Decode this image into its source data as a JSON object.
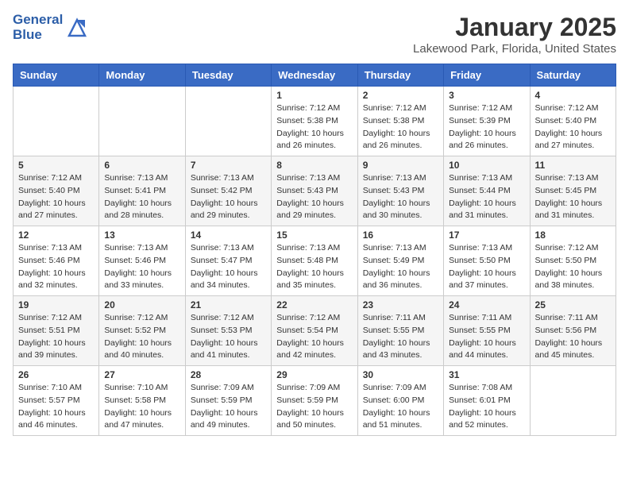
{
  "header": {
    "logo_general": "General",
    "logo_blue": "Blue",
    "title": "January 2025",
    "subtitle": "Lakewood Park, Florida, United States"
  },
  "weekdays": [
    "Sunday",
    "Monday",
    "Tuesday",
    "Wednesday",
    "Thursday",
    "Friday",
    "Saturday"
  ],
  "weeks": [
    [
      {
        "day": "",
        "info": ""
      },
      {
        "day": "",
        "info": ""
      },
      {
        "day": "",
        "info": ""
      },
      {
        "day": "1",
        "info": "Sunrise: 7:12 AM\nSunset: 5:38 PM\nDaylight: 10 hours\nand 26 minutes."
      },
      {
        "day": "2",
        "info": "Sunrise: 7:12 AM\nSunset: 5:38 PM\nDaylight: 10 hours\nand 26 minutes."
      },
      {
        "day": "3",
        "info": "Sunrise: 7:12 AM\nSunset: 5:39 PM\nDaylight: 10 hours\nand 26 minutes."
      },
      {
        "day": "4",
        "info": "Sunrise: 7:12 AM\nSunset: 5:40 PM\nDaylight: 10 hours\nand 27 minutes."
      }
    ],
    [
      {
        "day": "5",
        "info": "Sunrise: 7:12 AM\nSunset: 5:40 PM\nDaylight: 10 hours\nand 27 minutes."
      },
      {
        "day": "6",
        "info": "Sunrise: 7:13 AM\nSunset: 5:41 PM\nDaylight: 10 hours\nand 28 minutes."
      },
      {
        "day": "7",
        "info": "Sunrise: 7:13 AM\nSunset: 5:42 PM\nDaylight: 10 hours\nand 29 minutes."
      },
      {
        "day": "8",
        "info": "Sunrise: 7:13 AM\nSunset: 5:43 PM\nDaylight: 10 hours\nand 29 minutes."
      },
      {
        "day": "9",
        "info": "Sunrise: 7:13 AM\nSunset: 5:43 PM\nDaylight: 10 hours\nand 30 minutes."
      },
      {
        "day": "10",
        "info": "Sunrise: 7:13 AM\nSunset: 5:44 PM\nDaylight: 10 hours\nand 31 minutes."
      },
      {
        "day": "11",
        "info": "Sunrise: 7:13 AM\nSunset: 5:45 PM\nDaylight: 10 hours\nand 31 minutes."
      }
    ],
    [
      {
        "day": "12",
        "info": "Sunrise: 7:13 AM\nSunset: 5:46 PM\nDaylight: 10 hours\nand 32 minutes."
      },
      {
        "day": "13",
        "info": "Sunrise: 7:13 AM\nSunset: 5:46 PM\nDaylight: 10 hours\nand 33 minutes."
      },
      {
        "day": "14",
        "info": "Sunrise: 7:13 AM\nSunset: 5:47 PM\nDaylight: 10 hours\nand 34 minutes."
      },
      {
        "day": "15",
        "info": "Sunrise: 7:13 AM\nSunset: 5:48 PM\nDaylight: 10 hours\nand 35 minutes."
      },
      {
        "day": "16",
        "info": "Sunrise: 7:13 AM\nSunset: 5:49 PM\nDaylight: 10 hours\nand 36 minutes."
      },
      {
        "day": "17",
        "info": "Sunrise: 7:13 AM\nSunset: 5:50 PM\nDaylight: 10 hours\nand 37 minutes."
      },
      {
        "day": "18",
        "info": "Sunrise: 7:12 AM\nSunset: 5:50 PM\nDaylight: 10 hours\nand 38 minutes."
      }
    ],
    [
      {
        "day": "19",
        "info": "Sunrise: 7:12 AM\nSunset: 5:51 PM\nDaylight: 10 hours\nand 39 minutes."
      },
      {
        "day": "20",
        "info": "Sunrise: 7:12 AM\nSunset: 5:52 PM\nDaylight: 10 hours\nand 40 minutes."
      },
      {
        "day": "21",
        "info": "Sunrise: 7:12 AM\nSunset: 5:53 PM\nDaylight: 10 hours\nand 41 minutes."
      },
      {
        "day": "22",
        "info": "Sunrise: 7:12 AM\nSunset: 5:54 PM\nDaylight: 10 hours\nand 42 minutes."
      },
      {
        "day": "23",
        "info": "Sunrise: 7:11 AM\nSunset: 5:55 PM\nDaylight: 10 hours\nand 43 minutes."
      },
      {
        "day": "24",
        "info": "Sunrise: 7:11 AM\nSunset: 5:55 PM\nDaylight: 10 hours\nand 44 minutes."
      },
      {
        "day": "25",
        "info": "Sunrise: 7:11 AM\nSunset: 5:56 PM\nDaylight: 10 hours\nand 45 minutes."
      }
    ],
    [
      {
        "day": "26",
        "info": "Sunrise: 7:10 AM\nSunset: 5:57 PM\nDaylight: 10 hours\nand 46 minutes."
      },
      {
        "day": "27",
        "info": "Sunrise: 7:10 AM\nSunset: 5:58 PM\nDaylight: 10 hours\nand 47 minutes."
      },
      {
        "day": "28",
        "info": "Sunrise: 7:09 AM\nSunset: 5:59 PM\nDaylight: 10 hours\nand 49 minutes."
      },
      {
        "day": "29",
        "info": "Sunrise: 7:09 AM\nSunset: 5:59 PM\nDaylight: 10 hours\nand 50 minutes."
      },
      {
        "day": "30",
        "info": "Sunrise: 7:09 AM\nSunset: 6:00 PM\nDaylight: 10 hours\nand 51 minutes."
      },
      {
        "day": "31",
        "info": "Sunrise: 7:08 AM\nSunset: 6:01 PM\nDaylight: 10 hours\nand 52 minutes."
      },
      {
        "day": "",
        "info": ""
      }
    ]
  ]
}
